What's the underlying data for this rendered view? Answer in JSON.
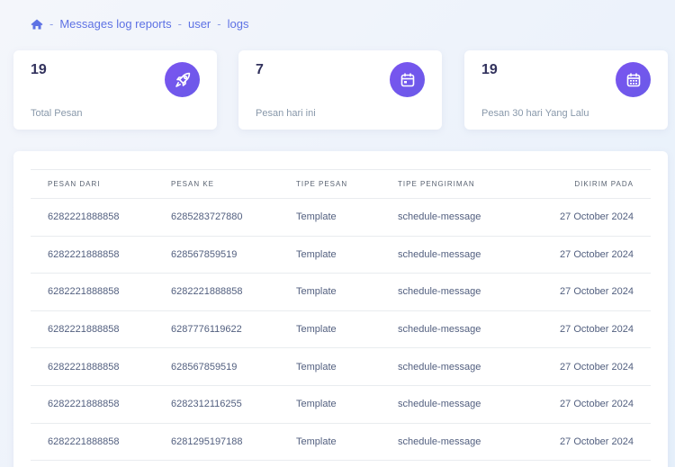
{
  "breadcrumb": {
    "separator": "-",
    "items": [
      "Messages log reports",
      "user",
      "logs"
    ]
  },
  "stats": [
    {
      "value": "19",
      "label": "Total Pesan",
      "icon": "rocket-icon"
    },
    {
      "value": "7",
      "label": "Pesan hari ini",
      "icon": "calendar-icon"
    },
    {
      "value": "19",
      "label": "Pesan 30 hari Yang Lalu",
      "icon": "calendar-grid-icon"
    }
  ],
  "colors": {
    "accent": "#5e72e4",
    "icon_gradient_start": "#7a54f0",
    "icon_gradient_end": "#6a5ae8"
  },
  "table": {
    "headers": [
      "Pesan Dari",
      "Pesan Ke",
      "Tipe Pesan",
      "Tipe Pengiriman",
      "Dikirim Pada"
    ],
    "rows": [
      [
        "6282221888858",
        "6285283727880",
        "Template",
        "schedule-message",
        "27 October 2024"
      ],
      [
        "6282221888858",
        "628567859519",
        "Template",
        "schedule-message",
        "27 October 2024"
      ],
      [
        "6282221888858",
        "6282221888858",
        "Template",
        "schedule-message",
        "27 October 2024"
      ],
      [
        "6282221888858",
        "6287776119622",
        "Template",
        "schedule-message",
        "27 October 2024"
      ],
      [
        "6282221888858",
        "628567859519",
        "Template",
        "schedule-message",
        "27 October 2024"
      ],
      [
        "6282221888858",
        "6282312116255",
        "Template",
        "schedule-message",
        "27 October 2024"
      ],
      [
        "6282221888858",
        "6281295197188",
        "Template",
        "schedule-message",
        "27 October 2024"
      ]
    ]
  }
}
